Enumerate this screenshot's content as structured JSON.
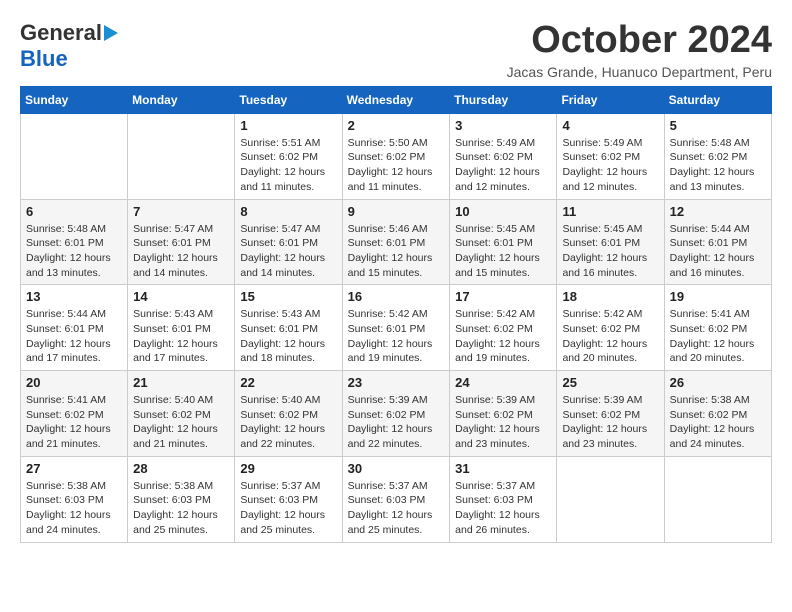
{
  "logo": {
    "line1": "General",
    "line2": "Blue"
  },
  "title": "October 2024",
  "location": "Jacas Grande, Huanuco Department, Peru",
  "days_of_week": [
    "Sunday",
    "Monday",
    "Tuesday",
    "Wednesday",
    "Thursday",
    "Friday",
    "Saturday"
  ],
  "weeks": [
    [
      {
        "day": "",
        "sunrise": "",
        "sunset": "",
        "daylight": ""
      },
      {
        "day": "",
        "sunrise": "",
        "sunset": "",
        "daylight": ""
      },
      {
        "day": "1",
        "sunrise": "Sunrise: 5:51 AM",
        "sunset": "Sunset: 6:02 PM",
        "daylight": "Daylight: 12 hours and 11 minutes."
      },
      {
        "day": "2",
        "sunrise": "Sunrise: 5:50 AM",
        "sunset": "Sunset: 6:02 PM",
        "daylight": "Daylight: 12 hours and 11 minutes."
      },
      {
        "day": "3",
        "sunrise": "Sunrise: 5:49 AM",
        "sunset": "Sunset: 6:02 PM",
        "daylight": "Daylight: 12 hours and 12 minutes."
      },
      {
        "day": "4",
        "sunrise": "Sunrise: 5:49 AM",
        "sunset": "Sunset: 6:02 PM",
        "daylight": "Daylight: 12 hours and 12 minutes."
      },
      {
        "day": "5",
        "sunrise": "Sunrise: 5:48 AM",
        "sunset": "Sunset: 6:02 PM",
        "daylight": "Daylight: 12 hours and 13 minutes."
      }
    ],
    [
      {
        "day": "6",
        "sunrise": "Sunrise: 5:48 AM",
        "sunset": "Sunset: 6:01 PM",
        "daylight": "Daylight: 12 hours and 13 minutes."
      },
      {
        "day": "7",
        "sunrise": "Sunrise: 5:47 AM",
        "sunset": "Sunset: 6:01 PM",
        "daylight": "Daylight: 12 hours and 14 minutes."
      },
      {
        "day": "8",
        "sunrise": "Sunrise: 5:47 AM",
        "sunset": "Sunset: 6:01 PM",
        "daylight": "Daylight: 12 hours and 14 minutes."
      },
      {
        "day": "9",
        "sunrise": "Sunrise: 5:46 AM",
        "sunset": "Sunset: 6:01 PM",
        "daylight": "Daylight: 12 hours and 15 minutes."
      },
      {
        "day": "10",
        "sunrise": "Sunrise: 5:45 AM",
        "sunset": "Sunset: 6:01 PM",
        "daylight": "Daylight: 12 hours and 15 minutes."
      },
      {
        "day": "11",
        "sunrise": "Sunrise: 5:45 AM",
        "sunset": "Sunset: 6:01 PM",
        "daylight": "Daylight: 12 hours and 16 minutes."
      },
      {
        "day": "12",
        "sunrise": "Sunrise: 5:44 AM",
        "sunset": "Sunset: 6:01 PM",
        "daylight": "Daylight: 12 hours and 16 minutes."
      }
    ],
    [
      {
        "day": "13",
        "sunrise": "Sunrise: 5:44 AM",
        "sunset": "Sunset: 6:01 PM",
        "daylight": "Daylight: 12 hours and 17 minutes."
      },
      {
        "day": "14",
        "sunrise": "Sunrise: 5:43 AM",
        "sunset": "Sunset: 6:01 PM",
        "daylight": "Daylight: 12 hours and 17 minutes."
      },
      {
        "day": "15",
        "sunrise": "Sunrise: 5:43 AM",
        "sunset": "Sunset: 6:01 PM",
        "daylight": "Daylight: 12 hours and 18 minutes."
      },
      {
        "day": "16",
        "sunrise": "Sunrise: 5:42 AM",
        "sunset": "Sunset: 6:01 PM",
        "daylight": "Daylight: 12 hours and 19 minutes."
      },
      {
        "day": "17",
        "sunrise": "Sunrise: 5:42 AM",
        "sunset": "Sunset: 6:02 PM",
        "daylight": "Daylight: 12 hours and 19 minutes."
      },
      {
        "day": "18",
        "sunrise": "Sunrise: 5:42 AM",
        "sunset": "Sunset: 6:02 PM",
        "daylight": "Daylight: 12 hours and 20 minutes."
      },
      {
        "day": "19",
        "sunrise": "Sunrise: 5:41 AM",
        "sunset": "Sunset: 6:02 PM",
        "daylight": "Daylight: 12 hours and 20 minutes."
      }
    ],
    [
      {
        "day": "20",
        "sunrise": "Sunrise: 5:41 AM",
        "sunset": "Sunset: 6:02 PM",
        "daylight": "Daylight: 12 hours and 21 minutes."
      },
      {
        "day": "21",
        "sunrise": "Sunrise: 5:40 AM",
        "sunset": "Sunset: 6:02 PM",
        "daylight": "Daylight: 12 hours and 21 minutes."
      },
      {
        "day": "22",
        "sunrise": "Sunrise: 5:40 AM",
        "sunset": "Sunset: 6:02 PM",
        "daylight": "Daylight: 12 hours and 22 minutes."
      },
      {
        "day": "23",
        "sunrise": "Sunrise: 5:39 AM",
        "sunset": "Sunset: 6:02 PM",
        "daylight": "Daylight: 12 hours and 22 minutes."
      },
      {
        "day": "24",
        "sunrise": "Sunrise: 5:39 AM",
        "sunset": "Sunset: 6:02 PM",
        "daylight": "Daylight: 12 hours and 23 minutes."
      },
      {
        "day": "25",
        "sunrise": "Sunrise: 5:39 AM",
        "sunset": "Sunset: 6:02 PM",
        "daylight": "Daylight: 12 hours and 23 minutes."
      },
      {
        "day": "26",
        "sunrise": "Sunrise: 5:38 AM",
        "sunset": "Sunset: 6:02 PM",
        "daylight": "Daylight: 12 hours and 24 minutes."
      }
    ],
    [
      {
        "day": "27",
        "sunrise": "Sunrise: 5:38 AM",
        "sunset": "Sunset: 6:03 PM",
        "daylight": "Daylight: 12 hours and 24 minutes."
      },
      {
        "day": "28",
        "sunrise": "Sunrise: 5:38 AM",
        "sunset": "Sunset: 6:03 PM",
        "daylight": "Daylight: 12 hours and 25 minutes."
      },
      {
        "day": "29",
        "sunrise": "Sunrise: 5:37 AM",
        "sunset": "Sunset: 6:03 PM",
        "daylight": "Daylight: 12 hours and 25 minutes."
      },
      {
        "day": "30",
        "sunrise": "Sunrise: 5:37 AM",
        "sunset": "Sunset: 6:03 PM",
        "daylight": "Daylight: 12 hours and 25 minutes."
      },
      {
        "day": "31",
        "sunrise": "Sunrise: 5:37 AM",
        "sunset": "Sunset: 6:03 PM",
        "daylight": "Daylight: 12 hours and 26 minutes."
      },
      {
        "day": "",
        "sunrise": "",
        "sunset": "",
        "daylight": ""
      },
      {
        "day": "",
        "sunrise": "",
        "sunset": "",
        "daylight": ""
      }
    ]
  ]
}
